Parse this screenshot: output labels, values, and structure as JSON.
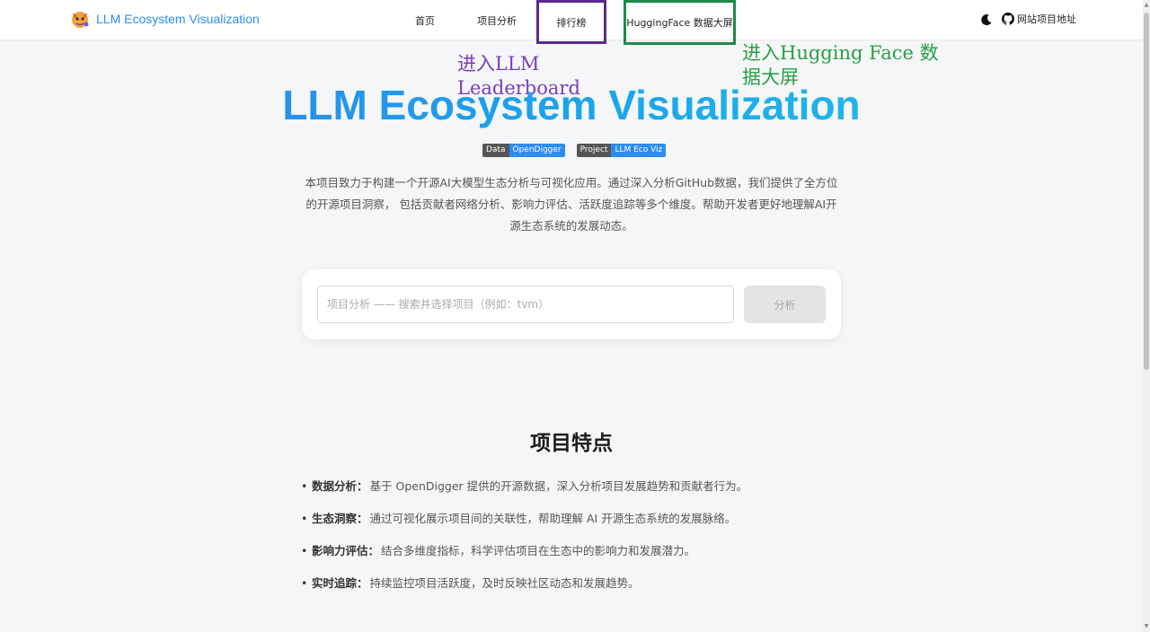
{
  "header": {
    "brand_title": "LLM Ecosystem Visualization",
    "brand_icon": "llama-logo-icon",
    "nav": {
      "home": "首页",
      "analysis": "项目分析",
      "leaderboard": "排行榜",
      "huggingface": "HuggingFace 数据大屏"
    },
    "theme_icon": "moon-icon",
    "github_label": "网站项目地址"
  },
  "annotations": {
    "leaderboard": "进入LLM Leaderboard",
    "huggingface": "进入Hugging Face 数据大屏"
  },
  "hero": {
    "title": "LLM Ecosystem Visualization",
    "badges": [
      {
        "label": "Data",
        "value": "OpenDigger"
      },
      {
        "label": "Project",
        "value": "LLM Eco Viz"
      }
    ],
    "intro": "本项目致力于构建一个开源AI大模型生态分析与可视化应用。通过深入分析GitHub数据，我们提供了全方位的开源项目洞察， 包括贡献者网络分析、影响力评估、活跃度追踪等多个维度。帮助开发者更好地理解AI开源生态系统的发展动态。"
  },
  "search": {
    "placeholder": "项目分析 —— 搜索并选择项目（例如：tvm）",
    "value": "",
    "button_label": "分析"
  },
  "features": {
    "title": "项目特点",
    "items": [
      {
        "name": "数据分析：",
        "desc": "基于 OpenDigger 提供的开源数据，深入分析项目发展趋势和贡献者行为。"
      },
      {
        "name": "生态洞察：",
        "desc": "通过可视化展示项目间的关联性，帮助理解 AI 开源生态系统的发展脉络。"
      },
      {
        "name": "影响力评估：",
        "desc": "结合多维度指标，科学评估项目在生态中的影响力和发展潜力。"
      },
      {
        "name": "实时追踪：",
        "desc": "持续监控项目活跃度，及时反映社区动态和发展趋势。"
      }
    ]
  },
  "colors": {
    "accent": "#2d8cf0",
    "annotation_purple": "#7a3db8",
    "annotation_green": "#27a045"
  }
}
